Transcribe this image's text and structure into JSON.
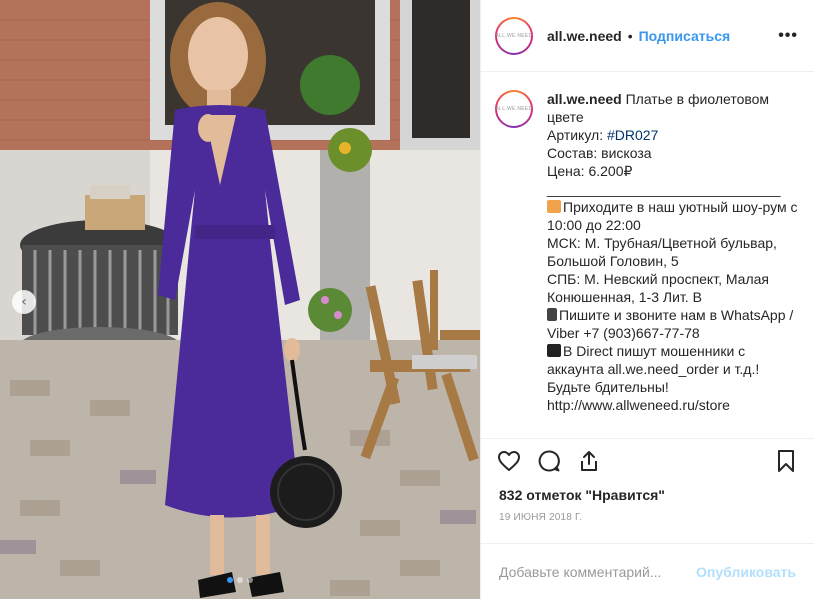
{
  "post": {
    "username": "all.we.need",
    "avatar_text": "ALL.WE.NEED",
    "bullet": "•",
    "follow_label": "Подписаться",
    "more_label": "•••"
  },
  "caption": {
    "username": "all.we.need",
    "title_rest": " Платье в фиолетовом цвете",
    "sku_prefix": "Артикул: ",
    "sku_tag": "#DR027",
    "composition": "Состав: вискоза",
    "price": "Цена: 6.200₽",
    "divider": "______________________________",
    "showroom": "Приходите в наш уютный шоу-рум с 10:00 до 22:00",
    "msk": "МСК: М. Трубная/Цветной бульвар, Большой Головин, 5",
    "spb": "СПБ: М. Невский проспект, Малая Конюшенная, 1-3 Лит. В",
    "contact": "Пишите и звоните нам в WhatsApp / Viber +7 (903)667-77-78",
    "warning": "В Direct пишут мошенники с аккаунта all.we.need_order и т.д.! Будьте бдительны!",
    "site": "http://www.allweneed.ru/store"
  },
  "actions": {
    "like_icon": "heart-icon",
    "comment_icon": "comment-icon",
    "share_icon": "share-icon",
    "save_icon": "bookmark-icon"
  },
  "likes_text": "832 отметок \"Нравится\"",
  "date_text": "19 ИЮНЯ 2018 Г.",
  "comment_box": {
    "placeholder": "Добавьте комментарий...",
    "publish_label": "Опубликовать"
  },
  "carousel": {
    "prev_icon": "chevron-left-icon",
    "slide_count": 3,
    "active_slide": 1
  },
  "colors": {
    "link": "#3897f0",
    "hashtag": "#003569",
    "publish_disabled": "#b2dffc",
    "dress": "#4b2a9a"
  }
}
